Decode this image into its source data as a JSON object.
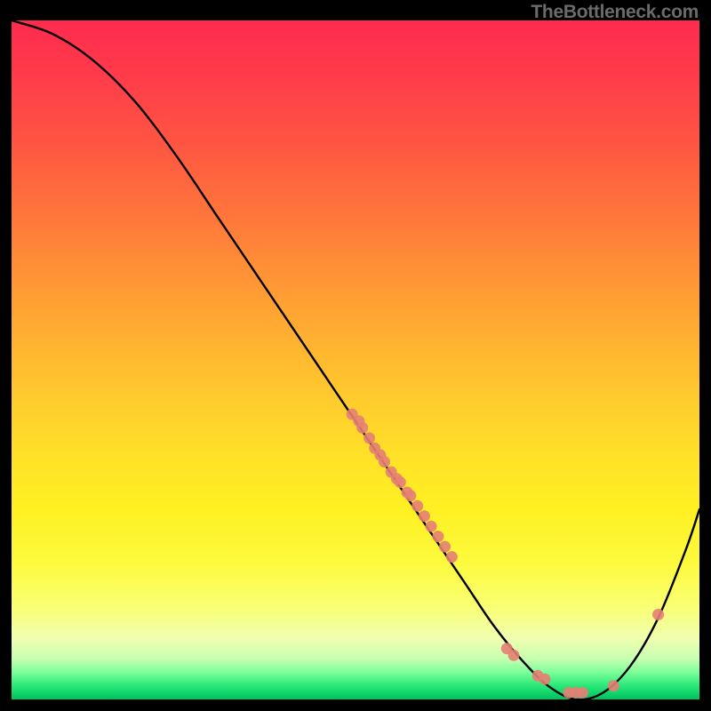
{
  "attribution": "TheBottleneck.com",
  "chart_data": {
    "type": "line",
    "title": "",
    "xlabel": "",
    "ylabel": "",
    "xlim": [
      0,
      100
    ],
    "ylim": [
      0,
      100
    ],
    "curve": {
      "x": [
        0,
        6,
        12,
        18,
        24,
        30,
        36,
        42,
        48,
        54,
        60,
        66,
        70,
        74,
        78,
        82,
        86,
        90,
        94,
        98,
        100
      ],
      "y": [
        100,
        98,
        94,
        88,
        80,
        71,
        62,
        53,
        44,
        35,
        26,
        17,
        11,
        6,
        2,
        0,
        1,
        5,
        12,
        22,
        28
      ]
    },
    "points": {
      "x": [
        49.5,
        50.5,
        51.0,
        52.0,
        52.8,
        53.6,
        54.2,
        55.2,
        56.0,
        56.5,
        57.5,
        58.0,
        59.0,
        60.0,
        61.0,
        62.0,
        63.0,
        64.0,
        72.0,
        73.0,
        76.5,
        77.5,
        81.0,
        82.0,
        83.0,
        87.5,
        94.0
      ],
      "y": [
        42.0,
        41.0,
        40.0,
        38.5,
        37.0,
        36.0,
        35.0,
        33.5,
        32.5,
        32.0,
        30.5,
        30.0,
        28.5,
        27.0,
        25.5,
        24.0,
        22.5,
        21.0,
        7.5,
        6.5,
        3.5,
        3.0,
        1.0,
        1.0,
        1.0,
        2.0,
        12.5
      ]
    },
    "point_color": "#e58074",
    "line_color": "#000000"
  }
}
